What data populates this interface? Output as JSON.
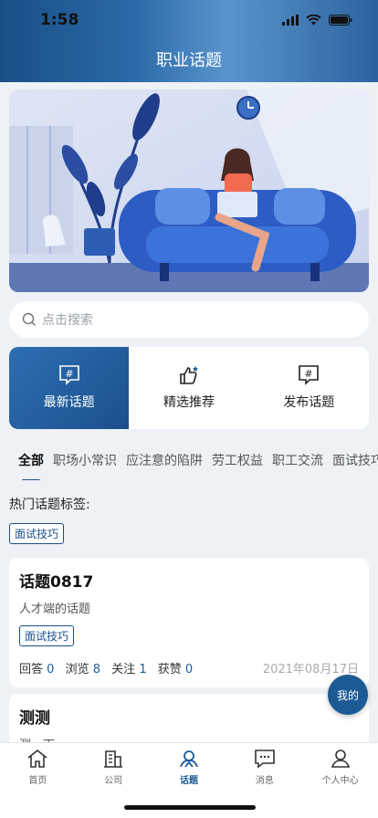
{
  "status": {
    "time": "1:58"
  },
  "header": {
    "title": "职业话题"
  },
  "search": {
    "placeholder": "点击搜索"
  },
  "actions": [
    {
      "label": "最新话题",
      "icon": "hash-icon"
    },
    {
      "label": "精选推荐",
      "icon": "thumbs-up-icon"
    },
    {
      "label": "发布话题",
      "icon": "hash-icon"
    }
  ],
  "tabs": [
    "全部",
    "职场小常识",
    "应注意的陷阱",
    "劳工权益",
    "职工交流",
    "面试技巧"
  ],
  "hot": {
    "title": "热门话题标签:",
    "tag": "面试技巧"
  },
  "cards": [
    {
      "title": "话题0817",
      "subtitle": "人才端的话题",
      "tag": "面试技巧",
      "stats": {
        "answers_label": "回答",
        "answers": "0",
        "views_label": "浏览",
        "views": "8",
        "follows_label": "关注",
        "follows": "1",
        "likes_label": "获赞",
        "likes": "0"
      },
      "date": "2021年08月17日"
    },
    {
      "title": "测测",
      "subtitle": "测一下"
    }
  ],
  "fab": {
    "label": "我的"
  },
  "tabbar": [
    {
      "label": "首页",
      "icon": "home-icon"
    },
    {
      "label": "公司",
      "icon": "building-icon"
    },
    {
      "label": "话题",
      "icon": "topic-icon"
    },
    {
      "label": "消息",
      "icon": "message-icon"
    },
    {
      "label": "个人中心",
      "icon": "profile-icon"
    }
  ],
  "colors": {
    "primary": "#1c5a96",
    "background": "#eef1f6"
  }
}
